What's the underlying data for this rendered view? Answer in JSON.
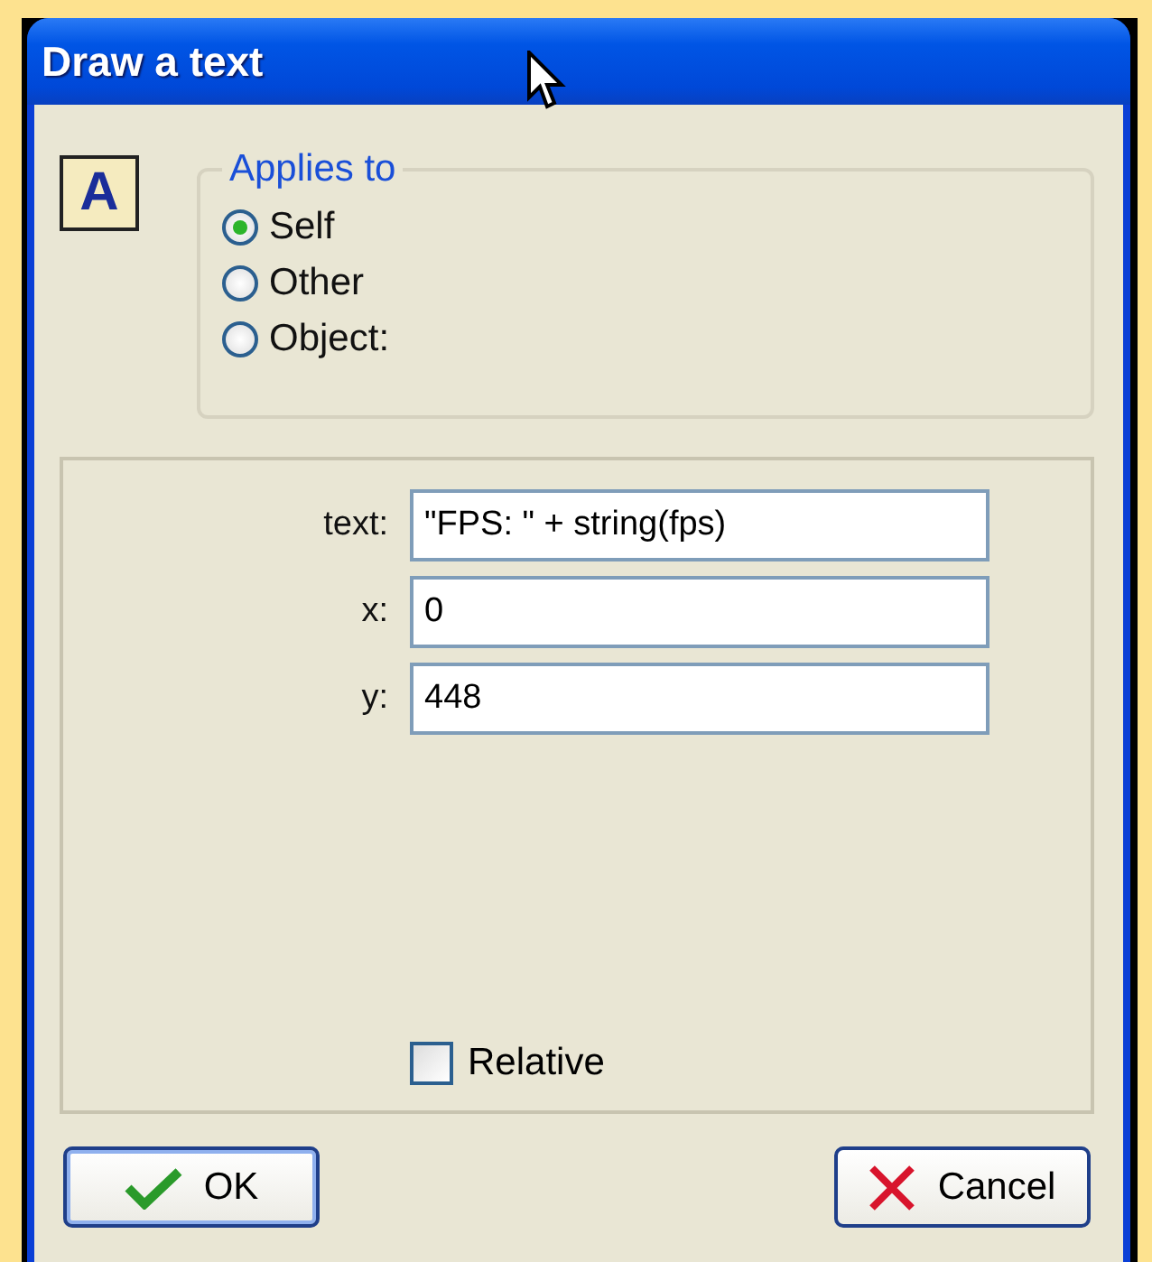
{
  "window": {
    "title": "Draw a text"
  },
  "icon": {
    "letter": "A"
  },
  "applies_to": {
    "legend": "Applies to",
    "options": [
      {
        "label": "Self",
        "selected": true
      },
      {
        "label": "Other",
        "selected": false
      },
      {
        "label": "Object:",
        "selected": false
      }
    ]
  },
  "fields": [
    {
      "label": "text:",
      "value": "\"FPS: \" + string(fps)"
    },
    {
      "label": "x:",
      "value": "0"
    },
    {
      "label": "y:",
      "value": "448"
    }
  ],
  "relative": {
    "label": "Relative",
    "checked": false
  },
  "buttons": [
    {
      "kind": "ok",
      "label": "OK"
    },
    {
      "kind": "cancel",
      "label": "Cancel"
    }
  ]
}
